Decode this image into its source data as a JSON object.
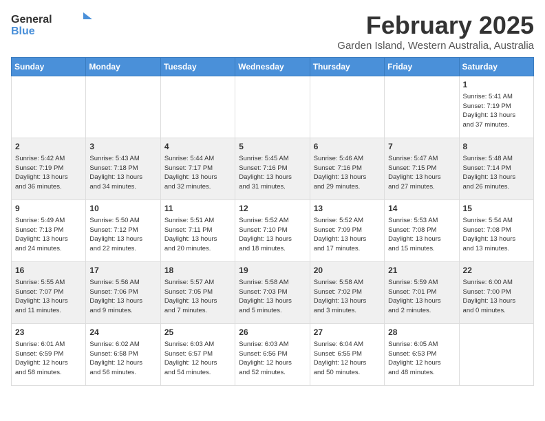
{
  "logo": {
    "general": "General",
    "blue": "Blue"
  },
  "header": {
    "title": "February 2025",
    "subtitle": "Garden Island, Western Australia, Australia"
  },
  "days_of_week": [
    "Sunday",
    "Monday",
    "Tuesday",
    "Wednesday",
    "Thursday",
    "Friday",
    "Saturday"
  ],
  "weeks": [
    [
      {
        "day": "",
        "info": ""
      },
      {
        "day": "",
        "info": ""
      },
      {
        "day": "",
        "info": ""
      },
      {
        "day": "",
        "info": ""
      },
      {
        "day": "",
        "info": ""
      },
      {
        "day": "",
        "info": ""
      },
      {
        "day": "1",
        "info": "Sunrise: 5:41 AM\nSunset: 7:19 PM\nDaylight: 13 hours\nand 37 minutes."
      }
    ],
    [
      {
        "day": "2",
        "info": "Sunrise: 5:42 AM\nSunset: 7:19 PM\nDaylight: 13 hours\nand 36 minutes."
      },
      {
        "day": "3",
        "info": "Sunrise: 5:43 AM\nSunset: 7:18 PM\nDaylight: 13 hours\nand 34 minutes."
      },
      {
        "day": "4",
        "info": "Sunrise: 5:44 AM\nSunset: 7:17 PM\nDaylight: 13 hours\nand 32 minutes."
      },
      {
        "day": "5",
        "info": "Sunrise: 5:45 AM\nSunset: 7:16 PM\nDaylight: 13 hours\nand 31 minutes."
      },
      {
        "day": "6",
        "info": "Sunrise: 5:46 AM\nSunset: 7:16 PM\nDaylight: 13 hours\nand 29 minutes."
      },
      {
        "day": "7",
        "info": "Sunrise: 5:47 AM\nSunset: 7:15 PM\nDaylight: 13 hours\nand 27 minutes."
      },
      {
        "day": "8",
        "info": "Sunrise: 5:48 AM\nSunset: 7:14 PM\nDaylight: 13 hours\nand 26 minutes."
      }
    ],
    [
      {
        "day": "9",
        "info": "Sunrise: 5:49 AM\nSunset: 7:13 PM\nDaylight: 13 hours\nand 24 minutes."
      },
      {
        "day": "10",
        "info": "Sunrise: 5:50 AM\nSunset: 7:12 PM\nDaylight: 13 hours\nand 22 minutes."
      },
      {
        "day": "11",
        "info": "Sunrise: 5:51 AM\nSunset: 7:11 PM\nDaylight: 13 hours\nand 20 minutes."
      },
      {
        "day": "12",
        "info": "Sunrise: 5:52 AM\nSunset: 7:10 PM\nDaylight: 13 hours\nand 18 minutes."
      },
      {
        "day": "13",
        "info": "Sunrise: 5:52 AM\nSunset: 7:09 PM\nDaylight: 13 hours\nand 17 minutes."
      },
      {
        "day": "14",
        "info": "Sunrise: 5:53 AM\nSunset: 7:08 PM\nDaylight: 13 hours\nand 15 minutes."
      },
      {
        "day": "15",
        "info": "Sunrise: 5:54 AM\nSunset: 7:08 PM\nDaylight: 13 hours\nand 13 minutes."
      }
    ],
    [
      {
        "day": "16",
        "info": "Sunrise: 5:55 AM\nSunset: 7:07 PM\nDaylight: 13 hours\nand 11 minutes."
      },
      {
        "day": "17",
        "info": "Sunrise: 5:56 AM\nSunset: 7:06 PM\nDaylight: 13 hours\nand 9 minutes."
      },
      {
        "day": "18",
        "info": "Sunrise: 5:57 AM\nSunset: 7:05 PM\nDaylight: 13 hours\nand 7 minutes."
      },
      {
        "day": "19",
        "info": "Sunrise: 5:58 AM\nSunset: 7:03 PM\nDaylight: 13 hours\nand 5 minutes."
      },
      {
        "day": "20",
        "info": "Sunrise: 5:58 AM\nSunset: 7:02 PM\nDaylight: 13 hours\nand 3 minutes."
      },
      {
        "day": "21",
        "info": "Sunrise: 5:59 AM\nSunset: 7:01 PM\nDaylight: 13 hours\nand 2 minutes."
      },
      {
        "day": "22",
        "info": "Sunrise: 6:00 AM\nSunset: 7:00 PM\nDaylight: 13 hours\nand 0 minutes."
      }
    ],
    [
      {
        "day": "23",
        "info": "Sunrise: 6:01 AM\nSunset: 6:59 PM\nDaylight: 12 hours\nand 58 minutes."
      },
      {
        "day": "24",
        "info": "Sunrise: 6:02 AM\nSunset: 6:58 PM\nDaylight: 12 hours\nand 56 minutes."
      },
      {
        "day": "25",
        "info": "Sunrise: 6:03 AM\nSunset: 6:57 PM\nDaylight: 12 hours\nand 54 minutes."
      },
      {
        "day": "26",
        "info": "Sunrise: 6:03 AM\nSunset: 6:56 PM\nDaylight: 12 hours\nand 52 minutes."
      },
      {
        "day": "27",
        "info": "Sunrise: 6:04 AM\nSunset: 6:55 PM\nDaylight: 12 hours\nand 50 minutes."
      },
      {
        "day": "28",
        "info": "Sunrise: 6:05 AM\nSunset: 6:53 PM\nDaylight: 12 hours\nand 48 minutes."
      },
      {
        "day": "",
        "info": ""
      }
    ]
  ]
}
